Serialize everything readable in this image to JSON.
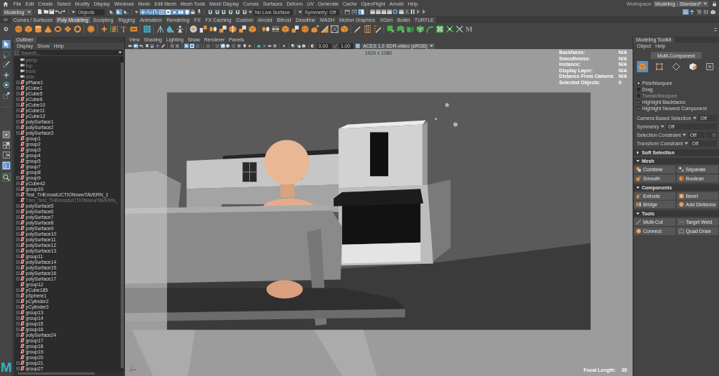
{
  "menu_bar": {
    "menus": [
      "File",
      "Edit",
      "Create",
      "Select",
      "Modify",
      "Display",
      "Windows",
      "Mesh",
      "Edit Mesh",
      "Mesh Tools",
      "Mesh Display",
      "Curves",
      "Surfaces",
      "Deform",
      "UV",
      "Generate",
      "Cache",
      "OpenFlight",
      "Arnold",
      "Help"
    ],
    "workspace_label": "Workspace:",
    "workspace": "Modeling - Standard*"
  },
  "status_line": {
    "mode": "Modeling",
    "selection_mode": "Objects",
    "hierarchy_buttons": [
      {
        "selected": false
      },
      {
        "selected": true
      },
      {
        "selected": false
      }
    ],
    "mask_buttons": [
      {
        "on": true
      },
      {
        "on": true
      },
      {
        "on": true
      },
      {
        "on": true
      },
      {
        "on": true
      },
      {
        "on": true
      },
      {
        "on": true
      },
      {
        "on": true
      }
    ],
    "snap_buttons": [
      {
        "on": false
      },
      {
        "on": false
      },
      {
        "on": false
      },
      {
        "on": false
      },
      {
        "on": false
      },
      {
        "on": false
      }
    ],
    "live_surface": "No Live Surface",
    "symmetry": "Symmetry: Off",
    "panel_buttons": [
      {
        "on": false
      },
      {
        "on": false
      },
      {
        "on": true
      }
    ],
    "side_buttons": [
      {
        "on": true
      },
      {
        "on": false
      },
      {
        "on": false
      },
      {
        "on": false
      },
      {
        "on": false
      }
    ]
  },
  "shelf": {
    "tabs": [
      {
        "label": "Curves / Surfaces",
        "selected": false
      },
      {
        "label": "Poly Modeling",
        "selected": true
      },
      {
        "label": "Sculpting",
        "selected": false
      },
      {
        "label": "Rigging",
        "selected": false
      },
      {
        "label": "Animation",
        "selected": false
      },
      {
        "label": "Rendering",
        "selected": false
      },
      {
        "label": "FX",
        "selected": false
      },
      {
        "label": "FX Caching",
        "selected": false
      },
      {
        "label": "Custom",
        "selected": false
      },
      {
        "label": "Arnold",
        "selected": false
      },
      {
        "label": "Bifrost",
        "selected": false
      },
      {
        "label": "Deadline",
        "selected": false
      },
      {
        "label": "MASH",
        "selected": false
      },
      {
        "label": "Motion Graphics",
        "selected": false
      },
      {
        "label": "XGen",
        "selected": false
      },
      {
        "label": "Bullet",
        "selected": false
      },
      {
        "label": "TURTLE",
        "selected": false
      }
    ],
    "text_tool_label": "T",
    "last_button_label": "M"
  },
  "toolbox": {
    "tools": [
      {
        "selected": true
      },
      {
        "selected": false
      },
      {
        "selected": false
      },
      {
        "selected": false
      },
      {
        "selected": false
      },
      {
        "selected": false
      }
    ],
    "layouts": [
      {
        "selected": false
      },
      {
        "selected": false
      },
      {
        "selected": false
      },
      {
        "selected": true
      }
    ],
    "logo": "M"
  },
  "outliner": {
    "title": "Outliner",
    "menus": [
      "Display",
      "Show",
      "Help"
    ],
    "search": {
      "placeholder": "Search..."
    },
    "items": [
      {
        "name": "persp",
        "kind": "camera",
        "hidden": true,
        "collapsed": false
      },
      {
        "name": "top",
        "kind": "camera",
        "hidden": true,
        "collapsed": false
      },
      {
        "name": "front",
        "kind": "camera",
        "hidden": true,
        "collapsed": false
      },
      {
        "name": "side",
        "kind": "camera",
        "hidden": true,
        "collapsed": false
      },
      {
        "name": "pPlane1",
        "kind": "mesh",
        "hidden": false,
        "collapsed": true
      },
      {
        "name": "pCube1",
        "kind": "mesh",
        "hidden": false,
        "collapsed": true
      },
      {
        "name": "pCube5",
        "kind": "mesh",
        "hidden": false,
        "collapsed": true
      },
      {
        "name": "pCube6",
        "kind": "mesh",
        "hidden": false,
        "collapsed": true
      },
      {
        "name": "pCube10",
        "kind": "mesh",
        "hidden": false,
        "collapsed": true
      },
      {
        "name": "pCube11",
        "kind": "mesh",
        "hidden": false,
        "collapsed": true
      },
      {
        "name": "pCube12",
        "kind": "mesh",
        "hidden": false,
        "collapsed": true
      },
      {
        "name": "polySurface1",
        "kind": "mesh",
        "hidden": false,
        "collapsed": true
      },
      {
        "name": "polySurface2",
        "kind": "mesh",
        "hidden": false,
        "collapsed": true
      },
      {
        "name": "polySurface3",
        "kind": "mesh",
        "hidden": false,
        "collapsed": true
      },
      {
        "name": "group1",
        "kind": "mesh",
        "hidden": false,
        "collapsed": false
      },
      {
        "name": "group2",
        "kind": "mesh",
        "hidden": false,
        "collapsed": false
      },
      {
        "name": "group3",
        "kind": "mesh",
        "hidden": false,
        "collapsed": false
      },
      {
        "name": "group4",
        "kind": "mesh",
        "hidden": false,
        "collapsed": false
      },
      {
        "name": "group5",
        "kind": "mesh",
        "hidden": false,
        "collapsed": false
      },
      {
        "name": "group7",
        "kind": "mesh",
        "hidden": false,
        "collapsed": false
      },
      {
        "name": "group8",
        "kind": "mesh",
        "hidden": false,
        "collapsed": false
      },
      {
        "name": "group9",
        "kind": "mesh",
        "hidden": false,
        "collapsed": true
      },
      {
        "name": "pCube42",
        "kind": "mesh",
        "hidden": false,
        "collapsed": true
      },
      {
        "name": "group10",
        "kind": "mesh",
        "hidden": false,
        "collapsed": true
      },
      {
        "name": "Test_THEmostUCTIONnewTAVERN_1",
        "kind": "mesh",
        "hidden": false,
        "collapsed": true
      },
      {
        "name": "Trim_Test_THEmostUCTIONnewTAVERN_",
        "kind": "mesh",
        "hidden": true,
        "collapsed": false
      },
      {
        "name": "polySurface5",
        "kind": "mesh",
        "hidden": false,
        "collapsed": true
      },
      {
        "name": "polySurface6",
        "kind": "mesh",
        "hidden": false,
        "collapsed": true
      },
      {
        "name": "polySurface7",
        "kind": "mesh",
        "hidden": false,
        "collapsed": true
      },
      {
        "name": "polySurface8",
        "kind": "mesh",
        "hidden": false,
        "collapsed": true
      },
      {
        "name": "polySurface9",
        "kind": "mesh",
        "hidden": false,
        "collapsed": true
      },
      {
        "name": "polySurface10",
        "kind": "mesh",
        "hidden": false,
        "collapsed": true
      },
      {
        "name": "polySurface11",
        "kind": "mesh",
        "hidden": false,
        "collapsed": true
      },
      {
        "name": "polySurface12",
        "kind": "mesh",
        "hidden": false,
        "collapsed": true
      },
      {
        "name": "polySurface13",
        "kind": "mesh",
        "hidden": false,
        "collapsed": true
      },
      {
        "name": "group11",
        "kind": "mesh",
        "hidden": false,
        "collapsed": true
      },
      {
        "name": "polySurface14",
        "kind": "mesh",
        "hidden": false,
        "collapsed": true
      },
      {
        "name": "polySurface15",
        "kind": "mesh",
        "hidden": false,
        "collapsed": true
      },
      {
        "name": "polySurface16",
        "kind": "mesh",
        "hidden": false,
        "collapsed": true
      },
      {
        "name": "polySurface17",
        "kind": "mesh",
        "hidden": false,
        "collapsed": true
      },
      {
        "name": "group12",
        "kind": "mesh",
        "hidden": false,
        "collapsed": false
      },
      {
        "name": "pCube185",
        "kind": "mesh",
        "hidden": false,
        "collapsed": true
      },
      {
        "name": "pSphere1",
        "kind": "mesh",
        "hidden": false,
        "collapsed": true
      },
      {
        "name": "pCylinder2",
        "kind": "mesh",
        "hidden": false,
        "collapsed": true
      },
      {
        "name": "pCylinder3",
        "kind": "mesh",
        "hidden": false,
        "collapsed": true
      },
      {
        "name": "group13",
        "kind": "mesh",
        "hidden": false,
        "collapsed": true
      },
      {
        "name": "group14",
        "kind": "mesh",
        "hidden": false,
        "collapsed": true
      },
      {
        "name": "group15",
        "kind": "mesh",
        "hidden": false,
        "collapsed": true
      },
      {
        "name": "group16",
        "kind": "mesh",
        "hidden": false,
        "collapsed": true
      },
      {
        "name": "polySurface24",
        "kind": "mesh",
        "hidden": false,
        "collapsed": true
      },
      {
        "name": "group17",
        "kind": "mesh",
        "hidden": false,
        "collapsed": false
      },
      {
        "name": "group18",
        "kind": "mesh",
        "hidden": false,
        "collapsed": false
      },
      {
        "name": "group19",
        "kind": "mesh",
        "hidden": false,
        "collapsed": false
      },
      {
        "name": "group20",
        "kind": "mesh",
        "hidden": false,
        "collapsed": false
      },
      {
        "name": "group21",
        "kind": "mesh",
        "hidden": false,
        "collapsed": true
      },
      {
        "name": "group27",
        "kind": "mesh",
        "hidden": false,
        "collapsed": true
      }
    ]
  },
  "viewport": {
    "menus": [
      "View",
      "Shading",
      "Lighting",
      "Show",
      "Renderer",
      "Panels"
    ],
    "toolbar": {
      "buttons": [
        {
          "on": false
        },
        {
          "on": true
        },
        {
          "on": false
        },
        {
          "on": false
        },
        {
          "on": false
        },
        {
          "on": false
        },
        {
          "on": false
        },
        {
          "on": false
        },
        {
          "on": false
        },
        {
          "on": true
        },
        {
          "on": true
        },
        {
          "on": false
        },
        {
          "on": false
        },
        {
          "on": false
        },
        {
          "on": false
        },
        {
          "on": true
        },
        {
          "on": false
        },
        {
          "on": false
        },
        {
          "on": false
        },
        {
          "on": false
        },
        {
          "on": false
        },
        {
          "on": false
        },
        {
          "on": false
        },
        {
          "on": false
        },
        {
          "on": false
        },
        {
          "on": false
        },
        {
          "on": false
        },
        {
          "on": false
        },
        {
          "on": false
        }
      ],
      "exposure": "0.00",
      "gamma": "1.00",
      "color_management": {
        "on": true
      },
      "view_transform": "ACES 1.0 SDR-video (sRGB)"
    },
    "resolution": "1920 x 1080",
    "hud": [
      {
        "label": "Backfaces:",
        "value": "N/A"
      },
      {
        "label": "Smoothness:",
        "value": "N/A"
      },
      {
        "label": "Instance:",
        "value": "N/A"
      },
      {
        "label": "Display Layer:",
        "value": "N/A"
      },
      {
        "label": "Distance From Camera:",
        "value": "N/A"
      },
      {
        "label": "Selected Objects:",
        "value": "0"
      }
    ],
    "focal_length_label": "Focal Length:",
    "focal_length": "35"
  },
  "modeling_toolkit": {
    "tab": "Modeling Toolkit",
    "menus": [
      "Object",
      "Help"
    ],
    "mode_button": "Multi-Component",
    "component_modes": [
      {
        "selected": true
      },
      {
        "selected": false
      },
      {
        "selected": false
      },
      {
        "selected": false
      },
      {
        "selected": false
      }
    ],
    "pick_modes": [
      {
        "label": "Pick/Marquee",
        "selected": true,
        "disabled": false
      },
      {
        "label": "Drag",
        "selected": false,
        "disabled": false
      },
      {
        "label": "Tweak/Marquee",
        "selected": false,
        "disabled": true
      }
    ],
    "options": [
      {
        "label": "Highlight Backfaces",
        "checked": true
      },
      {
        "label": "Highlight Nearest Component",
        "checked": true
      }
    ],
    "settings": [
      {
        "label": "Camera Based Selection",
        "value": "Off"
      },
      {
        "label": "Symmetry",
        "value": "Off"
      },
      {
        "label": "Selection Constraint",
        "value": "Off",
        "field": {
          "value": "0",
          "disabled": true
        }
      },
      {
        "label": "Transform Constraint",
        "value": "Off"
      }
    ],
    "sections": [
      {
        "title": "Soft Selection",
        "expanded": false
      },
      {
        "title": "Mesh",
        "expanded": true,
        "buttons": [
          "Combine",
          "Separate",
          "Smooth",
          "Boolean"
        ]
      },
      {
        "title": "Components",
        "expanded": true,
        "buttons": [
          "Extrude",
          "Bevel",
          "Bridge",
          "Add Divisions"
        ]
      },
      {
        "title": "Tools",
        "expanded": true,
        "buttons": [
          "Multi-Cut",
          "Target Weld",
          "Connect",
          "Quad Draw"
        ]
      }
    ]
  }
}
